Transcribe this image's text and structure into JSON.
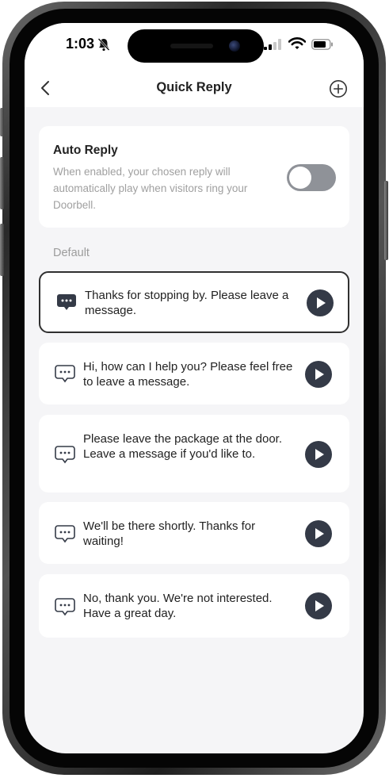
{
  "status_bar": {
    "time": "1:03"
  },
  "nav": {
    "title": "Quick Reply"
  },
  "auto_reply": {
    "title": "Auto Reply",
    "description": "When enabled, your chosen reply will automatically play when visitors ring your Doorbell.",
    "enabled": false
  },
  "section_label": "Default",
  "replies": [
    {
      "text": "Thanks for stopping by. Please leave a message.",
      "selected": true
    },
    {
      "text": "Hi, how can I help you? Please feel free to leave a message.",
      "selected": false
    },
    {
      "text": "Please leave the package at the door. Leave a message if you'd like to.",
      "selected": false
    },
    {
      "text": "We'll be there shortly. Thanks for waiting!",
      "selected": false
    },
    {
      "text": "No, thank you. We're not interested. Have a great day.",
      "selected": false
    }
  ],
  "colors": {
    "background": "#f5f5f7",
    "card": "#ffffff",
    "toggle_off": "#8f9298",
    "play_button": "#343a47",
    "selected_border": "#303030"
  },
  "icons": {
    "back": "chevron-left-icon",
    "add": "plus-circle-icon",
    "message": "message-bubble-icon",
    "play": "play-icon",
    "bell_off": "bell-slash-icon"
  }
}
